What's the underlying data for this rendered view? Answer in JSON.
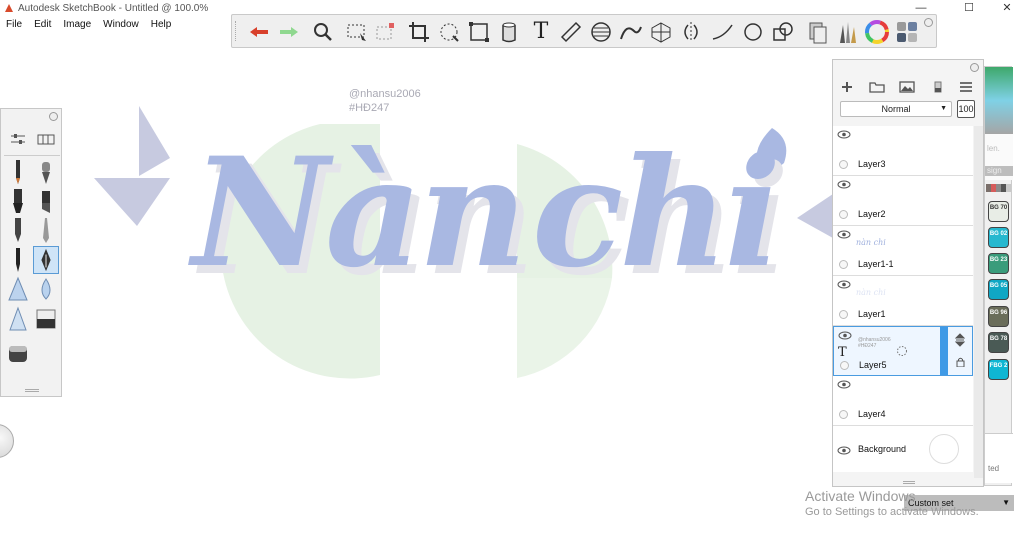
{
  "window": {
    "title": "Autodesk SketchBook - Untitled @ 100.0%",
    "controls": {
      "minimize": "—",
      "maximize": "☐",
      "close": "✕"
    }
  },
  "menu": [
    "File",
    "Edit",
    "Image",
    "Window",
    "Help"
  ],
  "toolbar": {
    "tools": [
      "undo",
      "redo",
      "zoom",
      "rectangle-select",
      "lasso-select",
      "crop",
      "transform",
      "distort",
      "fill",
      "text",
      "ruler",
      "ellipse",
      "french-curve",
      "perspective",
      "symmetry",
      "stroke",
      "circle",
      "shape",
      "copic-library",
      "brush-library",
      "color-wheel",
      "palette"
    ],
    "colors": {
      "undo": "#d8402b",
      "redo": "#7fd17f"
    },
    "text_tool_glyph": "T"
  },
  "palette": {
    "top_icons": [
      "brush-settings-icon",
      "brush-grid-icon"
    ],
    "brushes": [
      "pencil",
      "fountain-pen",
      "marker",
      "chisel-marker",
      "ballpoint",
      "ink-pen",
      "calligraphy",
      "ink-nib",
      "triangle-brush",
      "drop-brush",
      "airbrush",
      "eraser",
      "smudge"
    ],
    "selected": "ink-nib"
  },
  "canvas": {
    "credit_handle": "@nhansu2006",
    "credit_tag": "#HĐ247",
    "art_word_1": "Nàn",
    "art_word_2": "chi",
    "colors": {
      "lettering": "#a9b8e2",
      "shadow": "#e4e4ea",
      "circle": "#e6f2e4",
      "diamond": "#c7cae0"
    }
  },
  "layers": {
    "blend_mode": "Normal",
    "opacity": "100",
    "header_buttons": [
      "add-layer",
      "folder",
      "image-import",
      "merge",
      "menu"
    ],
    "rows": [
      {
        "name": "Layer3",
        "thumb": "",
        "selected": false
      },
      {
        "name": "Layer2",
        "thumb": "",
        "selected": false
      },
      {
        "name": "Layer1-1",
        "thumb": "nàn chi",
        "selected": false
      },
      {
        "name": "Layer1",
        "thumb": "nàn chi",
        "selected": false
      },
      {
        "name": "Layer5",
        "thumb": "@nhansu2006 #HĐ247",
        "selected": true,
        "type_glyph": "T"
      },
      {
        "name": "Layer4",
        "thumb": "",
        "selected": false
      }
    ],
    "background": "Background"
  },
  "swatches": {
    "faded_text": "len.",
    "bar_text": "sign",
    "markers": [
      {
        "code": "BG 70",
        "color": "#e8ede6"
      },
      {
        "code": "BG 02",
        "color": "#26b8cf"
      },
      {
        "code": "BG 23",
        "color": "#3a9c7b"
      },
      {
        "code": "BG 05",
        "color": "#10a7c4"
      },
      {
        "code": "BG 96",
        "color": "#6a6d5a"
      },
      {
        "code": "BG 78",
        "color": "#4a5a55"
      },
      {
        "code": "FBG 2",
        "color": "#0fb6d3"
      }
    ],
    "tail_text": "ted"
  },
  "custom_set": {
    "label": "Custom set",
    "caret": "▼"
  },
  "activation": {
    "line1": "Activate Windows",
    "line2": "Go to Settings to activate Windows."
  }
}
